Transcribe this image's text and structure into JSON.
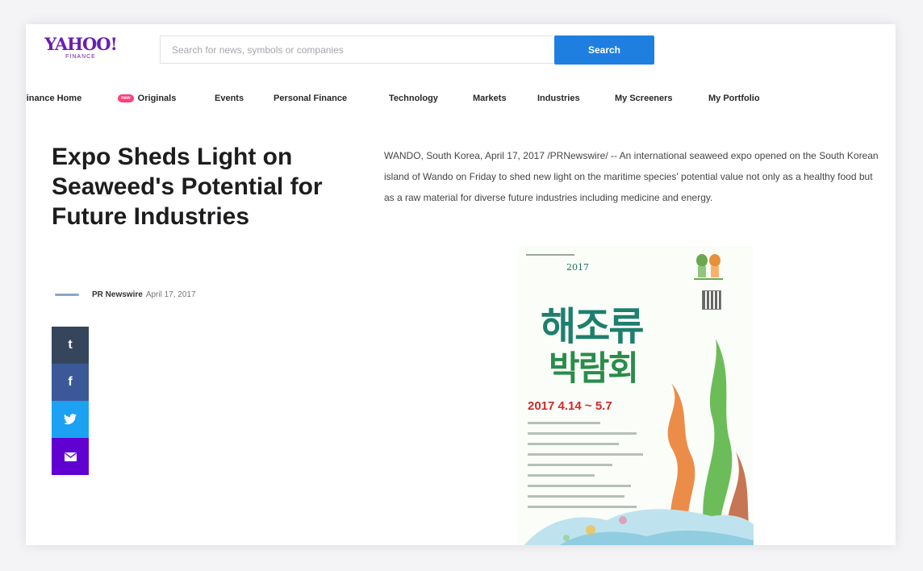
{
  "header": {
    "logo_main": "YAHOO!",
    "logo_sub": "FINANCE",
    "search_placeholder": "Search for news, symbols or companies",
    "search_button": "Search"
  },
  "nav": {
    "items": [
      {
        "label": "Finance Home"
      },
      {
        "label": "Originals",
        "badge": "new"
      },
      {
        "label": "Events"
      },
      {
        "label": "Personal Finance"
      },
      {
        "label": "Technology"
      },
      {
        "label": "Markets"
      },
      {
        "label": "Industries"
      },
      {
        "label": "My Screeners"
      },
      {
        "label": "My Portfolio"
      }
    ]
  },
  "article": {
    "headline": "Expo Sheds Light on Seaweed's Potential for Future Industries",
    "source": "PR Newswire",
    "date": "April 17, 2017",
    "body": "WANDO, South Korea, April 17, 2017 /PRNewswire/ -- An international seaweed expo opened on the South Korean island of Wando on Friday to shed new light on the maritime species' potential value not only as a healthy food but as a raw material for diverse future industries including medicine and energy."
  },
  "share": {
    "tumblr_glyph": "t",
    "facebook_glyph": "f",
    "twitter_glyph": "🐦",
    "mail_glyph": "✉"
  },
  "poster": {
    "year": "2017",
    "title_line1": "해조류",
    "title_line2": "박람회",
    "dates": "2017 4.14 ~ 5.7"
  },
  "colors": {
    "brand": "#6a1fb0",
    "search_button": "#1f7fe0",
    "tumblr": "#35465c",
    "facebook": "#3b5998",
    "twitter": "#1da1f2",
    "mail": "#6001d2"
  }
}
